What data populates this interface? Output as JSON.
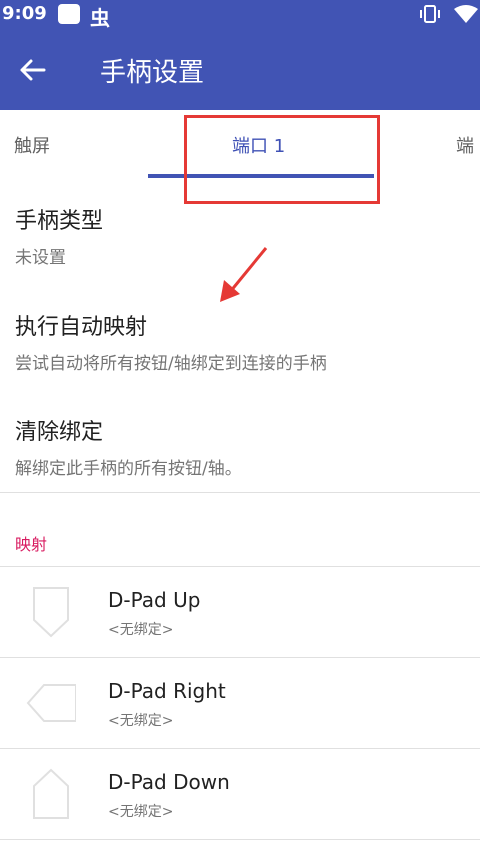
{
  "status_bar": {
    "time": "9:09",
    "bug_glyph": "虫"
  },
  "toolbar": {
    "title": "手柄设置"
  },
  "tabs": [
    {
      "label": "触屏"
    },
    {
      "label": "端口 1"
    },
    {
      "label": "端"
    }
  ],
  "settings": [
    {
      "title": "手柄类型",
      "summary": "未设置"
    },
    {
      "title": "执行自动映射",
      "summary": "尝试自动将所有按钮/轴绑定到连接的手柄"
    },
    {
      "title": "清除绑定",
      "summary": "解绑定此手柄的所有按钮/轴。"
    }
  ],
  "mapping": {
    "category": "映射",
    "items": [
      {
        "name": "D-Pad Up",
        "binding": "<无绑定>",
        "icon": "dpad-up-icon"
      },
      {
        "name": "D-Pad Right",
        "binding": "<无绑定>",
        "icon": "dpad-right-icon"
      },
      {
        "name": "D-Pad Down",
        "binding": "<无绑定>",
        "icon": "dpad-down-icon"
      }
    ]
  },
  "colors": {
    "primary": "#4154b4",
    "accent": "#d81b60",
    "annotation": "#e53935"
  }
}
